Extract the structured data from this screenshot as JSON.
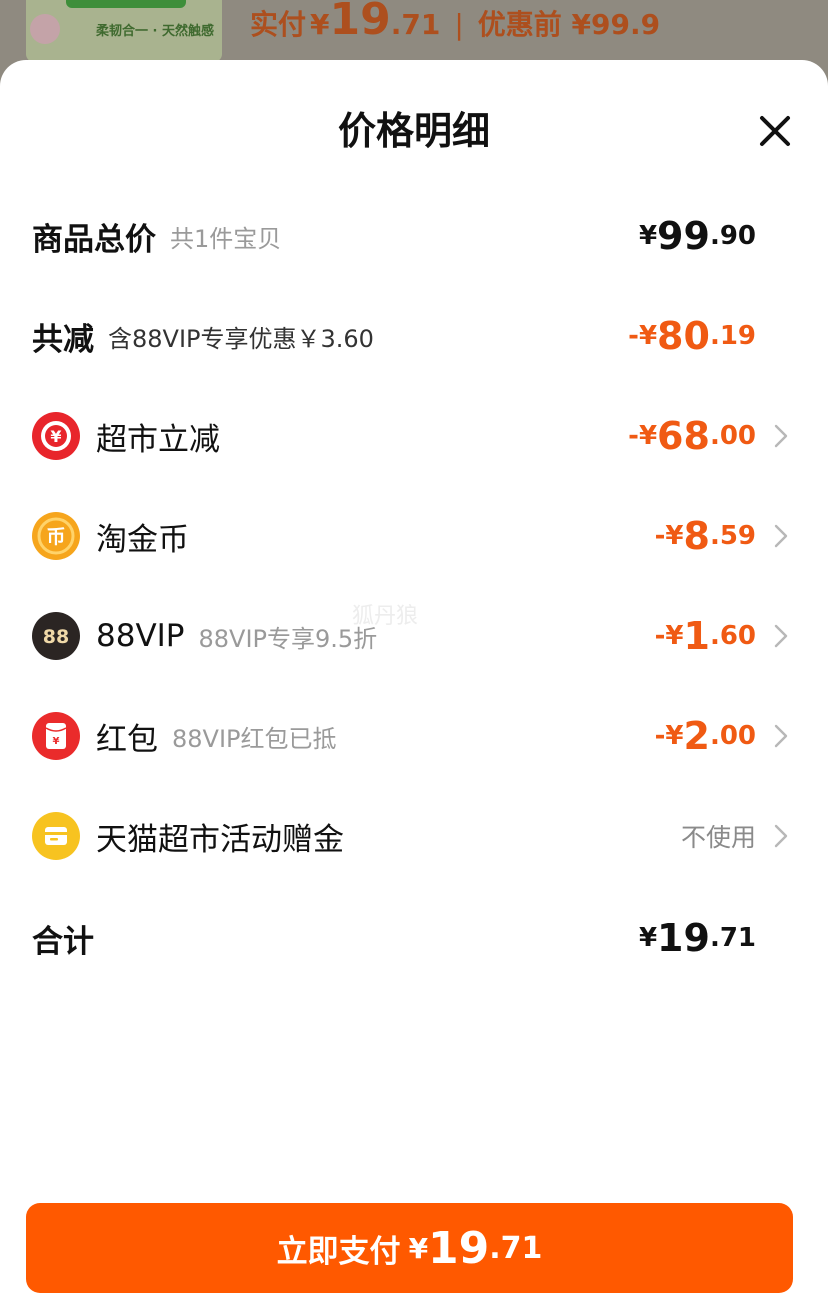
{
  "background": {
    "banner_text": "柔韧合一 · 天然触感",
    "price_label": "实付",
    "price_currency": "¥",
    "price_integer": "19",
    "price_decimal": ".71",
    "separator": "|",
    "original_price": "优惠前 ¥99.9"
  },
  "sheet": {
    "title": "价格明细"
  },
  "rows": {
    "total": {
      "label": "商品总价",
      "sub": "共1件宝贝",
      "currency": "¥",
      "integer": "99",
      "decimal": ".90"
    },
    "discount": {
      "label": "共减",
      "sub": "含88VIP专享优惠￥3.60",
      "currency": "-¥",
      "integer": "80",
      "decimal": ".19"
    },
    "market": {
      "label": "超市立减",
      "icon_glyph": "¥",
      "currency": "-¥",
      "integer": "68",
      "decimal": ".00"
    },
    "coin": {
      "label": "淘金币",
      "icon_glyph": "币",
      "currency": "-¥",
      "integer": "8",
      "decimal": ".59"
    },
    "vip": {
      "label": "88VIP",
      "sub": "88VIP专享9.5折",
      "icon_glyph": "88",
      "currency": "-¥",
      "integer": "1",
      "decimal": ".60"
    },
    "redpacket": {
      "label": "红包",
      "sub": "88VIP红包已抵",
      "icon_glyph": "¥",
      "currency": "-¥",
      "integer": "2",
      "decimal": ".00"
    },
    "bonus": {
      "label": "天猫超市活动赠金",
      "value": "不使用"
    },
    "sum": {
      "label": "合计",
      "currency": "¥",
      "integer": "19",
      "decimal": ".71"
    }
  },
  "pay_button": {
    "label": "立即支付",
    "currency": "¥",
    "integer": "19",
    "decimal": ".71"
  },
  "watermark": "狐丹狼",
  "colors": {
    "accent_orange": "#f05a13",
    "button_orange": "#ff5900",
    "market_icon_red": "#e8252b",
    "coin_icon_gold": "#f6a51c",
    "vip_icon_dark": "#2b2523",
    "redpacket_icon_red": "#ea2b2b",
    "bonus_icon_yellow": "#f7c320"
  },
  "icons": {
    "close": "close-icon",
    "market": "market-discount-icon",
    "coin": "gold-coin-icon",
    "vip": "vip-88-icon",
    "redpacket": "red-packet-icon",
    "bonus": "gift-card-icon",
    "chevron": "chevron-right-icon"
  }
}
